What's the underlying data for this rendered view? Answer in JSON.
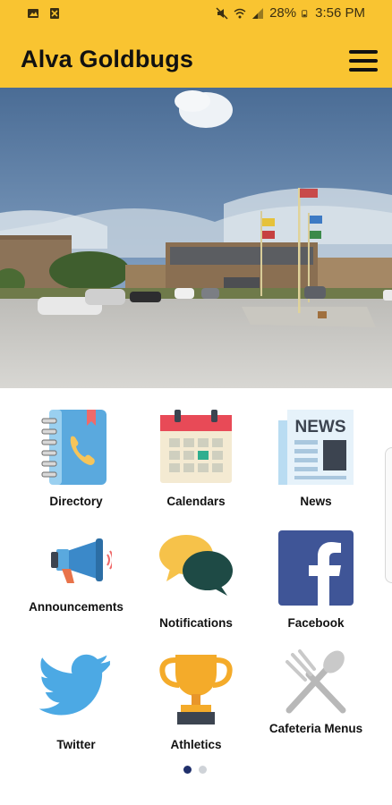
{
  "status_bar": {
    "battery": "28%",
    "time": "3:56 PM"
  },
  "app": {
    "title": "Alva Goldbugs"
  },
  "carousel": {
    "slide_count": 5,
    "active_index": 0
  },
  "tiles": [
    {
      "label": "Directory",
      "icon": "directory-icon"
    },
    {
      "label": "Calendars",
      "icon": "calendar-icon"
    },
    {
      "label": "News",
      "icon": "news-icon"
    },
    {
      "label": "Announcements",
      "icon": "megaphone-icon"
    },
    {
      "label": "Notifications",
      "icon": "chat-bubbles-icon"
    },
    {
      "label": "Facebook",
      "icon": "facebook-icon"
    },
    {
      "label": "Twitter",
      "icon": "twitter-icon"
    },
    {
      "label": "Athletics",
      "icon": "trophy-icon"
    },
    {
      "label": "Cafeteria Menus",
      "icon": "fork-spoon-icon"
    }
  ],
  "pager": {
    "page_count": 2,
    "active_index": 0
  },
  "colors": {
    "brand": "#f9c431",
    "pager_active": "#1f2f6b"
  }
}
